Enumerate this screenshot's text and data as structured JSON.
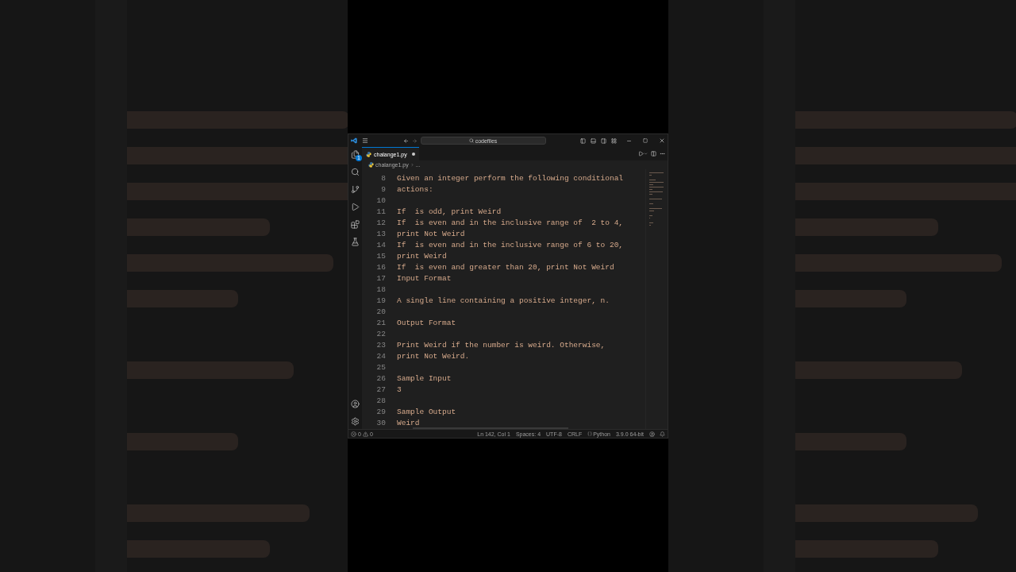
{
  "title_bar": {
    "search": "codefiles"
  },
  "activity_bar": {
    "explorer_badge": "1"
  },
  "tabs": [
    {
      "label": "chalange1.py",
      "selected": true,
      "modified": true
    }
  ],
  "breadcrumb": [
    "chalange1.py",
    "..."
  ],
  "lines": [
    {
      "number": "8",
      "text": "Given an integer perform the following conditional"
    },
    {
      "number": "9",
      "text": "actions:"
    },
    {
      "number": "10"
    },
    {
      "number": "11",
      "text": "If  is odd, print Weird"
    },
    {
      "number": "12",
      "text": "If  is even and in the inclusive range of  2 to 4,"
    },
    {
      "number": "13",
      "text": "print Not Weird"
    },
    {
      "number": "14",
      "text": "If  is even and in the inclusive range of 6 to 20,"
    },
    {
      "number": "15",
      "text": "print Weird"
    },
    {
      "number": "16",
      "text": "If  is even and greater than 20, print Not Weird"
    },
    {
      "number": "17",
      "text": "Input Format"
    },
    {
      "number": "18"
    },
    {
      "number": "19",
      "text": "A single line containing a positive integer, n."
    },
    {
      "number": "20"
    },
    {
      "number": "21",
      "text": "Output Format"
    },
    {
      "number": "22"
    },
    {
      "number": "23",
      "text": "Print Weird if the number is weird. Otherwise,"
    },
    {
      "number": "24",
      "text": "print Not Weird."
    },
    {
      "number": "25"
    },
    {
      "number": "26",
      "text": "Sample Input"
    },
    {
      "number": "27",
      "text": "3"
    },
    {
      "number": "28"
    },
    {
      "number": "29",
      "text": "Sample Output"
    },
    {
      "number": "30",
      "text": "Weird"
    }
  ],
  "status_bar": {
    "errors": "0",
    "warnings": "0",
    "items": [
      {
        "kind": "text",
        "text": "Ln 142, Col 1"
      },
      {
        "kind": "text",
        "text": "Spaces: 4"
      },
      {
        "kind": "text",
        "text": "UTF-8"
      },
      {
        "kind": "text",
        "text": "CRLF"
      },
      {
        "kind": "language",
        "text": "Python"
      },
      {
        "kind": "text",
        "text": "3.9.0 64-bit"
      }
    ]
  }
}
